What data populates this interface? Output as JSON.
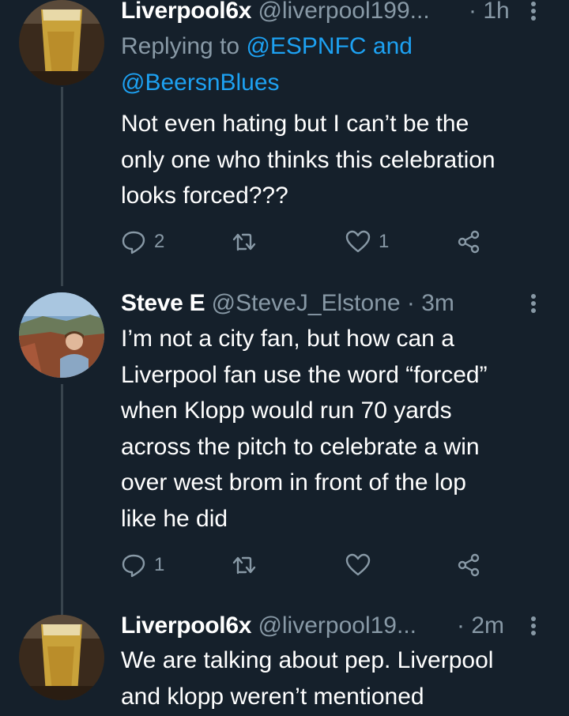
{
  "colors": {
    "background": "#15202b",
    "text_primary": "#ffffff",
    "text_secondary": "#8899a6",
    "link": "#1da1f2",
    "thread_line": "#38444d"
  },
  "tweets": [
    {
      "name": "Liverpool6x",
      "handle": "@liverpool199...",
      "time": "· 1h",
      "replying_prefix": "Replying to ",
      "replying_user1": "@ESPNFC",
      "replying_and": " and",
      "replying_user2": "@BeersnBlues",
      "text_lines": [
        "Not even hating but I can’t be the",
        "only one who thinks this celebration",
        "looks forced???"
      ],
      "reply_count": "2",
      "retweet_count": "",
      "like_count": "1",
      "avatar_icon": "beer-glass-avatar"
    },
    {
      "name": "Steve E",
      "handle": "@SteveJ_Elstone",
      "time": "· 3m",
      "text_lines": [
        "I’m not a city fan, but how can a",
        "Liverpool fan use the word “forced”",
        "when Klopp would run 70 yards",
        "across the pitch to celebrate a win",
        "over west brom in front of the lop",
        "like he did"
      ],
      "reply_count": "1",
      "retweet_count": "",
      "like_count": "",
      "avatar_icon": "person-outdoors-avatar"
    },
    {
      "name": "Liverpool6x",
      "handle": "@liverpool19...",
      "time": "· 2m",
      "text_lines": [
        "We are talking about pep. Liverpool",
        "and klopp weren’t mentioned"
      ],
      "avatar_icon": "beer-glass-avatar"
    }
  ],
  "icons": {
    "reply": "reply-icon",
    "retweet": "retweet-icon",
    "like": "heart-icon",
    "share": "share-icon",
    "more": "more-vertical-icon"
  }
}
